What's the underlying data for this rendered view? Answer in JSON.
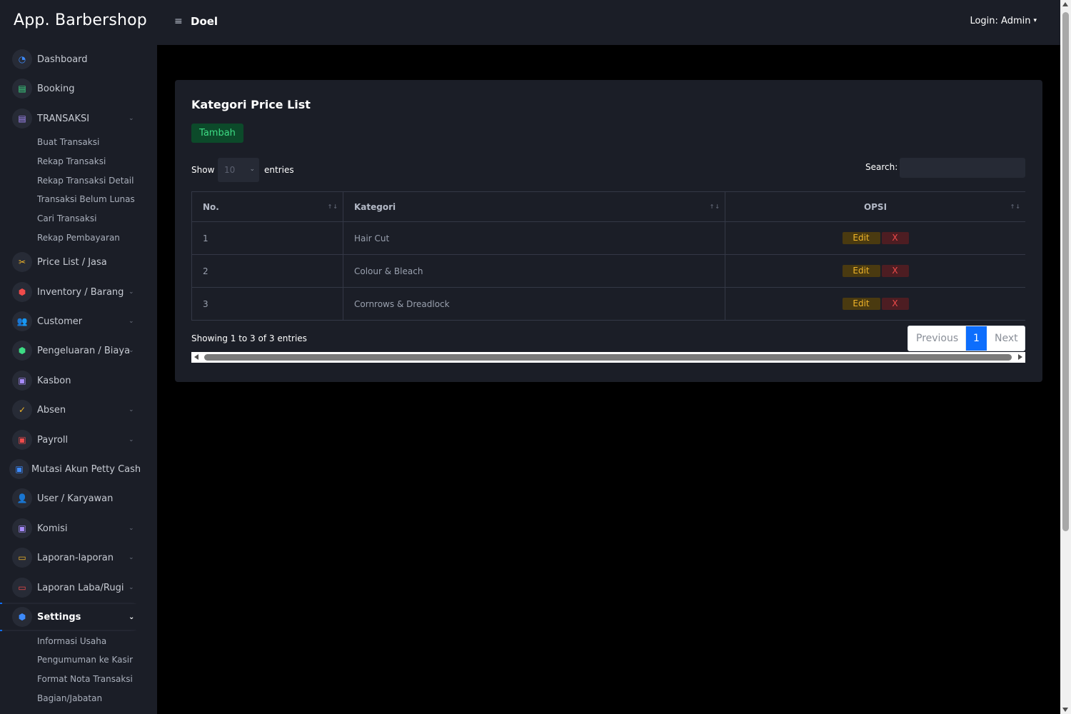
{
  "header": {
    "brand": "App. Barbershop",
    "menu_icon": "≡",
    "user": "Doel",
    "login_label": "Login: Admin",
    "login_caret": "▾"
  },
  "sidebar": {
    "items": [
      {
        "label": "Dashboard",
        "icon": "gauge-icon",
        "glyph": "◔",
        "color": "#3d8bfd",
        "chevron": ""
      },
      {
        "label": "Booking",
        "icon": "list-icon",
        "glyph": "▤",
        "color": "#3ddc84",
        "chevron": ""
      },
      {
        "label": "TRANSAKSI",
        "icon": "document-icon",
        "glyph": "▤",
        "color": "#a78bfa",
        "chevron": "⌄"
      },
      {
        "label": "Price List / Jasa",
        "icon": "scissors-icon",
        "glyph": "✂",
        "color": "#f0b429",
        "chevron": ""
      },
      {
        "label": "Inventory / Barang",
        "icon": "shield-icon",
        "glyph": "⬢",
        "color": "#f04b4b",
        "chevron": "⌄"
      },
      {
        "label": "Customer",
        "icon": "people-icon",
        "glyph": "👥",
        "color": "#3d8bfd",
        "chevron": "⌄"
      },
      {
        "label": "Pengeluaran / Biaya",
        "icon": "shield-check-icon",
        "glyph": "⬢",
        "color": "#3ddc84",
        "chevron": "⌄"
      },
      {
        "label": "Kasbon",
        "icon": "money-icon",
        "glyph": "▣",
        "color": "#a78bfa",
        "chevron": ""
      },
      {
        "label": "Absen",
        "icon": "check-icon",
        "glyph": "✓",
        "color": "#f0b429",
        "chevron": "⌄"
      },
      {
        "label": "Payroll",
        "icon": "payroll-icon",
        "glyph": "▣",
        "color": "#f04b4b",
        "chevron": "⌄"
      },
      {
        "label": "Mutasi Akun Petty Cash",
        "icon": "wallet-icon",
        "glyph": "▣",
        "color": "#3d8bfd",
        "chevron": ""
      },
      {
        "label": "User / Karyawan",
        "icon": "user-icon",
        "glyph": "👤",
        "color": "#3ddc84",
        "chevron": ""
      },
      {
        "label": "Komisi",
        "icon": "commission-icon",
        "glyph": "▣",
        "color": "#a78bfa",
        "chevron": "⌄"
      },
      {
        "label": "Laporan-laporan",
        "icon": "laptop-icon",
        "glyph": "▭",
        "color": "#f0b429",
        "chevron": "⌄"
      },
      {
        "label": "Laporan Laba/Rugi",
        "icon": "laptop-icon",
        "glyph": "▭",
        "color": "#f04b4b",
        "chevron": "⌄"
      },
      {
        "label": "Settings",
        "icon": "shield-settings-icon",
        "glyph": "⬢",
        "color": "#3d8bfd",
        "chevron": "⌄"
      }
    ],
    "transaksi_sub": [
      "Buat Transaksi",
      "Rekap Transaksi",
      "Rekap Transaksi Detail",
      "Transaksi Belum Lunas",
      "Cari Transaksi",
      "Rekap Pembayaran"
    ],
    "settings_sub": [
      "Informasi Usaha",
      "Pengumuman ke Kasir",
      "Format Nota Transaksi",
      "Bagian/Jabatan"
    ]
  },
  "card": {
    "title": "Kategori Price List",
    "add_button": "Tambah",
    "show_label": "Show",
    "page_length": "10",
    "entries_label": "entries",
    "search_label": "Search:",
    "search_value": "",
    "columns": [
      "No.",
      "Kategori",
      "OPSI"
    ],
    "rows": [
      {
        "no": "1",
        "kategori": "Hair Cut"
      },
      {
        "no": "2",
        "kategori": "Colour & Bleach"
      },
      {
        "no": "3",
        "kategori": "Cornrows & Dreadlock"
      }
    ],
    "edit_label": "Edit",
    "delete_label": "X",
    "info": "Showing 1 to 3 of 3 entries",
    "pagination": {
      "previous": "Previous",
      "current": "1",
      "next": "Next"
    }
  },
  "colors": {
    "accent": "#0d6efd",
    "success": "#3ddc84",
    "warning": "#f0b429",
    "danger": "#f04b4b",
    "panel": "#1b1e27"
  }
}
